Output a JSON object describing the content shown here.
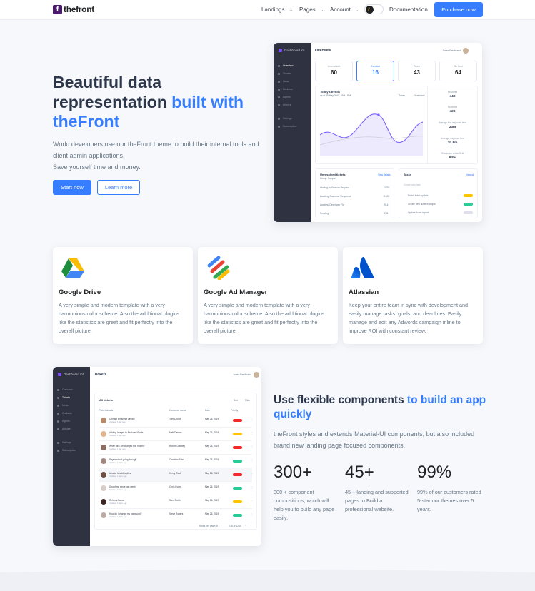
{
  "nav": {
    "brand": "thefront",
    "brand_initial": "f",
    "menu": [
      {
        "label": "Landings"
      },
      {
        "label": "Pages"
      },
      {
        "label": "Account"
      }
    ],
    "theme_toggle_icon": "moon-icon",
    "documentation": "Documentation",
    "purchase": "Purchase now"
  },
  "hero": {
    "title_part1": "Beautiful data representation",
    "title_accent": "built with theFront",
    "subtitle": "World developers use our theFront theme to build their internal tools and client admin applications.",
    "subtitle2": "Save yourself time and money.",
    "primary_cta": "Start now",
    "secondary_cta": "Learn more"
  },
  "overview_panel": {
    "brand": "Dashboard Kit",
    "title": "Overview",
    "user": "Jones Ferdinand",
    "sidebar": [
      "Overview",
      "Tickets",
      "Ideas",
      "Contacts",
      "Agents",
      "Articles",
      "Settings",
      "Subscription"
    ],
    "stats": [
      {
        "label": "Unresolved",
        "value": "60"
      },
      {
        "label": "Overdue",
        "value": "16"
      },
      {
        "label": "Open",
        "value": "43"
      },
      {
        "label": "On hold",
        "value": "64"
      }
    ],
    "trends_title": "Today's trends",
    "trends_sub": "as of 25 May 2019, 09:41 PM",
    "legend_today": "Today",
    "legend_yesterday": "Yesterday",
    "kpis": [
      {
        "label": "Resolved",
        "value": "449"
      },
      {
        "label": "Received",
        "value": "426"
      },
      {
        "label": "Average first response time",
        "value": "33m"
      },
      {
        "label": "Average response time",
        "value": "3h 8m"
      },
      {
        "label": "Resolution within SLA",
        "value": "94%"
      }
    ],
    "unresolved": {
      "title": "Unresolved tickets",
      "link": "View details",
      "group": "Group: Support",
      "rows": [
        {
          "name": "Waiting on Feature Request",
          "count": "4238"
        },
        {
          "name": "Awaiting Customer Response",
          "count": "1005"
        },
        {
          "name": "Awaiting Developer Fix",
          "count": "914"
        },
        {
          "name": "Pending",
          "count": "281"
        }
      ]
    },
    "tasks": {
      "title": "Tasks",
      "link": "View all",
      "placeholder": "Create new task",
      "items": [
        {
          "name": "Finish ticket update",
          "tag": "Urgent",
          "color": "#fec400"
        },
        {
          "name": "Create new ticket example",
          "tag": "New",
          "color": "#29cc97"
        },
        {
          "name": "Update ticket report",
          "tag": "Default",
          "color": "#dfe0eb"
        }
      ]
    }
  },
  "features": [
    {
      "title": "Google Drive",
      "icon": "google-drive-icon",
      "desc": "A very simple and modern template with a very harmonious color scheme. Also the additional plugins like the statistics are great and fit perfectly into the overall picture."
    },
    {
      "title": "Google Ad Manager",
      "icon": "google-ad-manager-icon",
      "desc": "A very simple and modern template with a very harmonious color scheme. Also the additional plugins like the statistics are great and fit perfectly into the overall picture."
    },
    {
      "title": "Atlassian",
      "icon": "atlassian-icon",
      "desc": "Keep your entire team in sync with development and easily manage tasks, goals, and deadlines. Easily manage and edit any Adwords campaign inline to improve ROI with constant review."
    }
  ],
  "tickets_panel": {
    "brand": "Dashboard Kit",
    "title": "Tickets",
    "user": "Jones Ferdinand",
    "sidebar": [
      "Overview",
      "Tickets",
      "Ideas",
      "Contacts",
      "Agents",
      "Articles",
      "Settings",
      "Subscription"
    ],
    "list_title": "All tickets",
    "sort": "Sort",
    "filter": "Filter",
    "columns": [
      "Ticket details",
      "Customer name",
      "Date",
      "Priority"
    ],
    "rows": [
      {
        "title": "Contact Email not Linked",
        "sub": "Updated 1 day ago",
        "customer": "Tom Cruise",
        "date": "May 26, 2019",
        "priority": "High",
        "color": "#f12b2c",
        "av": "#b98a6b"
      },
      {
        "title": "Adding Images to Featured Posts",
        "sub": "Updated 1 day ago",
        "customer": "Matt Damon",
        "date": "May 26, 2019",
        "priority": "Low",
        "color": "#fec400",
        "av": "#e0b48c"
      },
      {
        "title": "When will I be charged this month?",
        "sub": "Updated 1 day ago",
        "customer": "Robert Downey",
        "date": "May 26, 2019",
        "priority": "High",
        "color": "#f12b2c",
        "av": "#8d6e63"
      },
      {
        "title": "Payment not going through",
        "sub": "Updated 2 days ago",
        "customer": "Christian Bale",
        "date": "May 25, 2019",
        "priority": "Normal",
        "color": "#29cc97",
        "av": "#a1887f"
      },
      {
        "title": "Unable to add replies",
        "sub": "Updated 2 days ago",
        "customer": "Henry Cavil",
        "date": "May 26, 2019",
        "priority": "High",
        "color": "#f12b2c",
        "av": "#6d4c41"
      },
      {
        "title": "Downtime since last week",
        "sub": "Updated 2 days ago",
        "customer": "Chris Evans",
        "date": "May 26, 2019",
        "priority": "Normal",
        "color": "#29cc97",
        "av": "#d7ccc8"
      },
      {
        "title": "Referral Bonus",
        "sub": "Updated 2 days ago",
        "customer": "Sam Smith",
        "date": "May 26, 2019",
        "priority": "Low",
        "color": "#fec400",
        "av": "#3e2723"
      },
      {
        "title": "How do I change my password?",
        "sub": "Updated 2 days ago",
        "customer": "Steve Rogers",
        "date": "May 26, 2019",
        "priority": "Normal",
        "color": "#29cc97",
        "av": "#bcaaa4"
      }
    ],
    "pagination": "Rows per page: 8",
    "page_range": "1-8 of 1240"
  },
  "section2": {
    "title": "Use flexible components",
    "title_accent": "to build an app quickly",
    "subtitle": "theFront styles and extends Material-UI components, but also included brand new landing page focused components.",
    "stats": [
      {
        "value": "300+",
        "caption": "300 + component compositions, which will help you to build any page easily."
      },
      {
        "value": "45+",
        "caption": "45 + landing and supported pages to Build a professional website."
      },
      {
        "value": "99%",
        "caption": "99% of our customers rated 5-star our themes over 5 years."
      }
    ]
  },
  "colors": {
    "accent": "#377dff",
    "heading": "#2d374b",
    "muted": "#677788",
    "sidebar": "#2f3240"
  }
}
